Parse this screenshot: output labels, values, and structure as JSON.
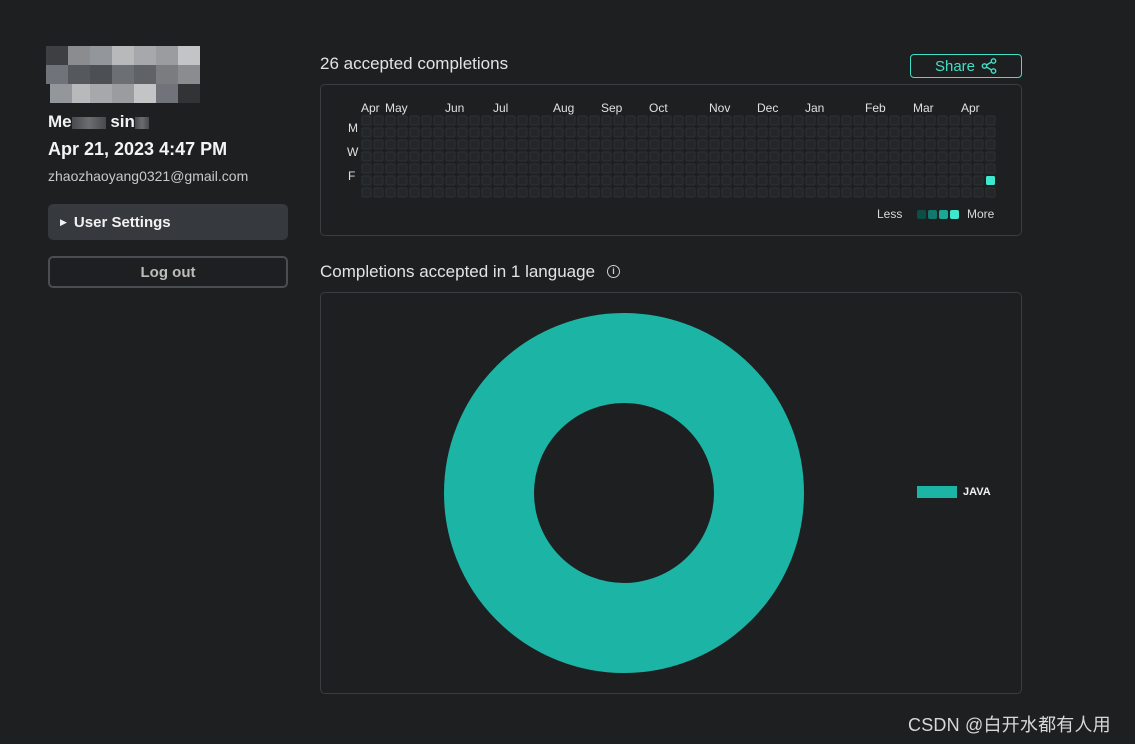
{
  "profile": {
    "member_line": "Me",
    "member_tail": " sin",
    "signup_date": "Apr 21, 2023 4:47 PM",
    "email": "zhaozhaoyang0321@gmail.com",
    "user_settings_label": "User Settings",
    "logout_label": "Log out"
  },
  "activity": {
    "title": "26 accepted completions",
    "share_label": "Share",
    "months": [
      "Apr",
      "May",
      "Jun",
      "Jul",
      "Aug",
      "Sep",
      "Oct",
      "Nov",
      "Dec",
      "Jan",
      "Feb",
      "Mar",
      "Apr"
    ],
    "days": [
      "M",
      "W",
      "F"
    ],
    "legend_less": "Less",
    "legend_more": "More",
    "colors": {
      "empty": "#24272a",
      "border": "#2e3134",
      "level1": "#0c4e46",
      "level2": "#127a6d",
      "level3": "#1ba896",
      "level4": "#3ee8cf"
    },
    "active_cell": {
      "week_index": 52,
      "day_index": 5,
      "level": 4
    }
  },
  "languages": {
    "title": "Completions accepted in 1 language",
    "info_icon": "info-circle-icon",
    "chart_data": {
      "type": "pie",
      "donut": true,
      "categories": [
        "JAVA"
      ],
      "values": [
        26
      ],
      "colors": [
        "#1cb5a5"
      ]
    }
  },
  "watermark": "CSDN @白开水都有人用"
}
